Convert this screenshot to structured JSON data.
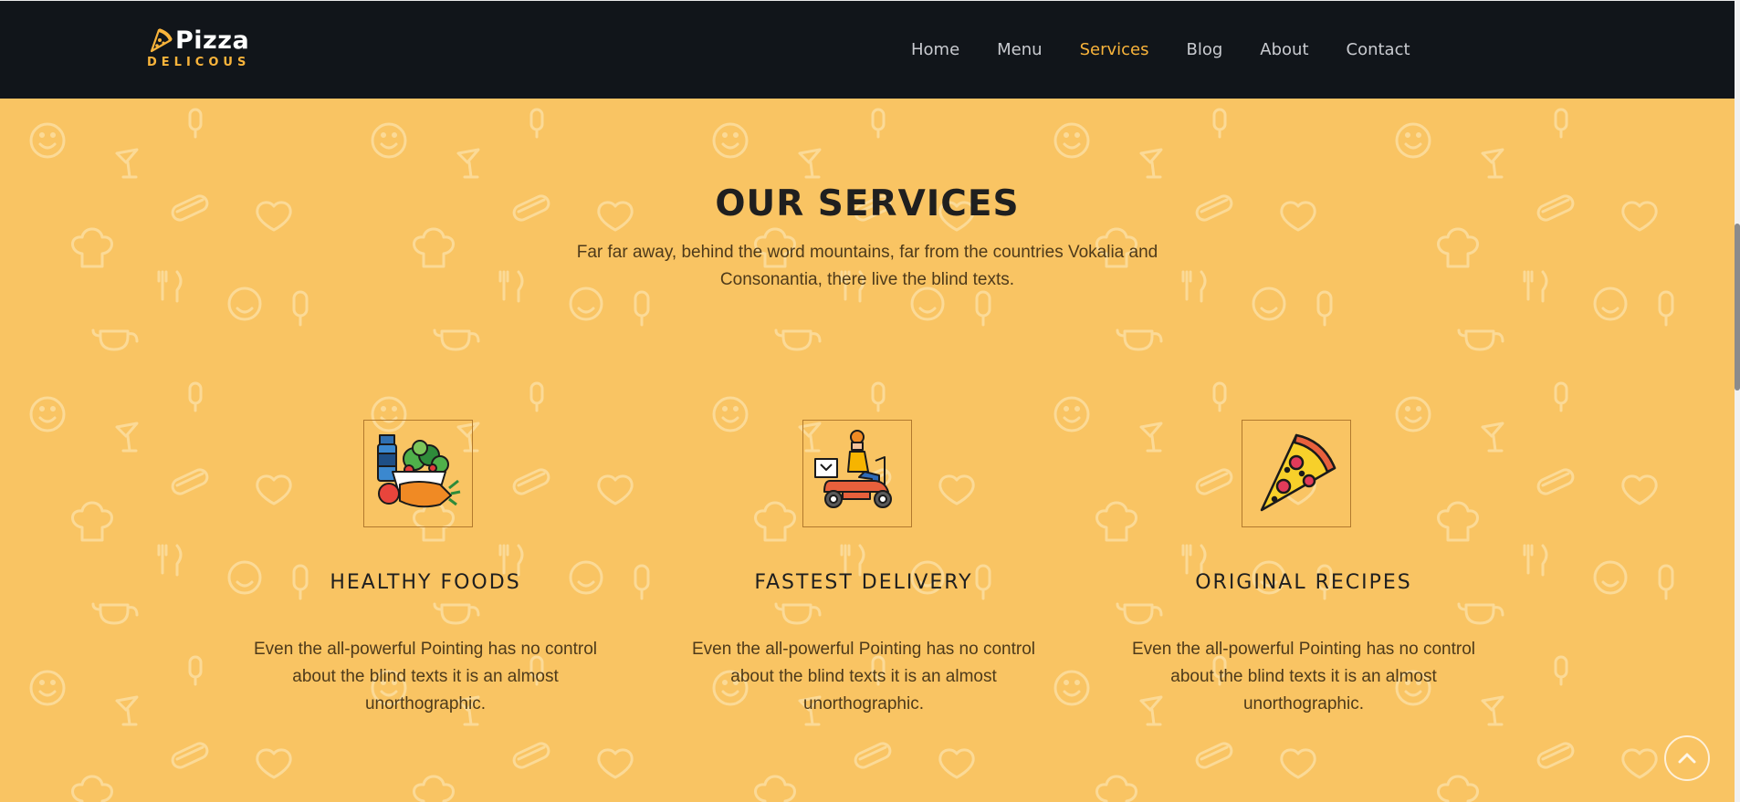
{
  "brand": {
    "name": "Pizza",
    "tagline": "DELICOUS",
    "icon": "pizza-slice-icon"
  },
  "nav": [
    {
      "label": "Home",
      "active": false
    },
    {
      "label": "Menu",
      "active": false
    },
    {
      "label": "Services",
      "active": true
    },
    {
      "label": "Blog",
      "active": false
    },
    {
      "label": "About",
      "active": false
    },
    {
      "label": "Contact",
      "active": false
    }
  ],
  "section": {
    "title": "OUR SERVICES",
    "subtitle": "Far far away, behind the word mountains, far from the countries Vokalia and Consonantia, there live the blind texts."
  },
  "services": [
    {
      "title": "HEALTHY FOODS",
      "text": "Even the all-powerful Pointing has no control about the blind texts it is an almost unorthographic.",
      "icon": "groceries-icon"
    },
    {
      "title": "FASTEST DELIVERY",
      "text": "Even the all-powerful Pointing has no control about the blind texts it is an almost unorthographic.",
      "icon": "delivery-scooter-icon"
    },
    {
      "title": "ORIGINAL RECIPES",
      "text": "Even the all-powerful Pointing has no control about the blind texts it is an almost unorthographic.",
      "icon": "pizza-slice-icon"
    }
  ],
  "colors": {
    "background": "#f9c463",
    "navbar": "#11151a",
    "accent": "#f9b43b",
    "heading": "#1f1f1f",
    "body_text": "#4e3a1a"
  },
  "scroll_top": {
    "icon": "chevron-up-icon"
  }
}
